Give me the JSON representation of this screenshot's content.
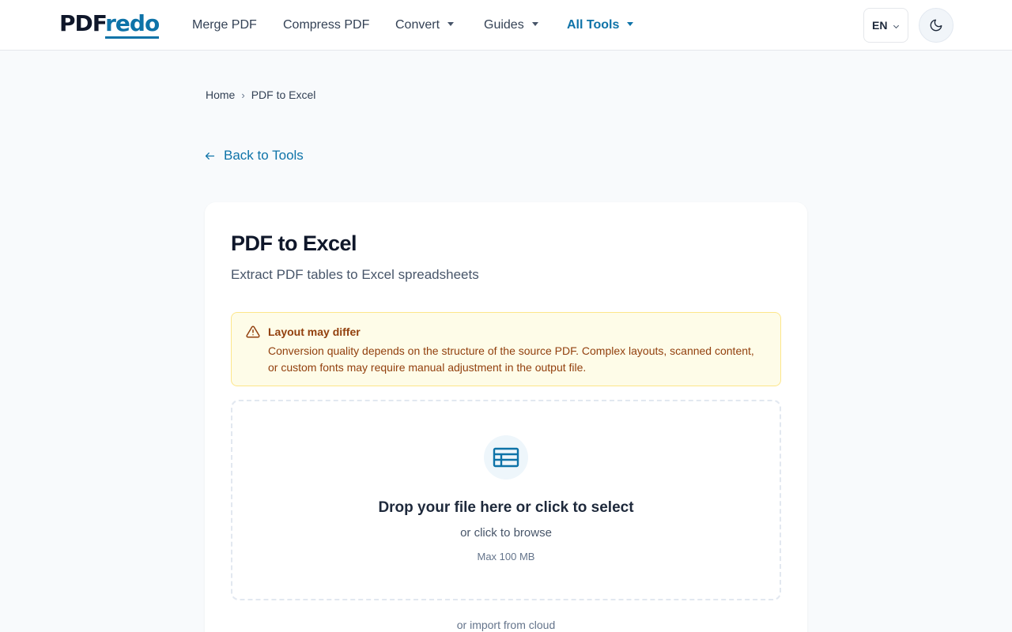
{
  "brand": {
    "part1": "PDF",
    "part2": "redo",
    "accent": "#0e73a8"
  },
  "nav": {
    "merge": "Merge PDF",
    "compress": "Compress PDF",
    "convert": "Convert",
    "guides": "Guides",
    "all_tools": "All Tools"
  },
  "header": {
    "language": "EN",
    "theme_icon": "moon-icon"
  },
  "breadcrumb": {
    "home": "Home",
    "current": "PDF to Excel"
  },
  "back_link": "Back to Tools",
  "tool": {
    "title": "PDF to Excel",
    "subtitle": "Extract PDF tables to Excel spreadsheets"
  },
  "warning": {
    "title": "Layout may differ",
    "text": "Conversion quality depends on the structure of the source PDF. Complex layouts, scanned content, or custom fonts may require manual adjustment in the output file.",
    "icon": "warning-triangle-icon",
    "color": "#92400e",
    "background": "#fefce8"
  },
  "dropzone": {
    "icon": "spreadsheet-icon",
    "title": "Drop your file here or click to select",
    "subtitle": "or click to browse",
    "max_size": "Max 100 MB"
  },
  "cloud_import": "or import from cloud"
}
